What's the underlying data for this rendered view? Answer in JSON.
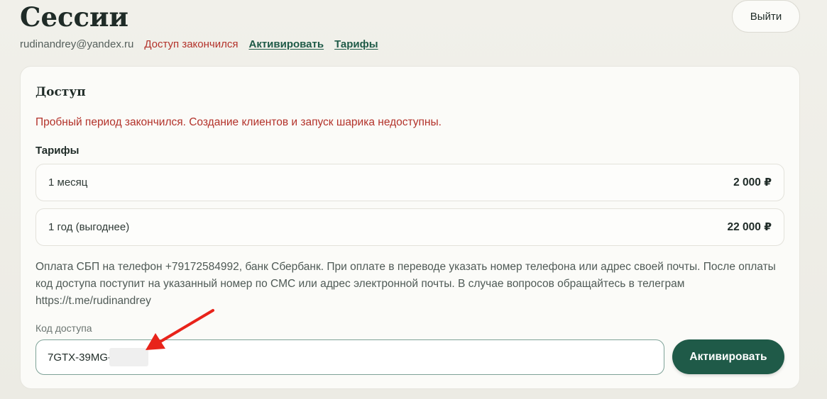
{
  "header": {
    "title": "Сессии",
    "logout_label": "Выйти"
  },
  "status": {
    "email": "rudinandrey@yandex.ru",
    "access_state": "Доступ закончился",
    "activate_link": "Активировать",
    "tariffs_link": "Тарифы"
  },
  "access": {
    "title": "Доступ",
    "warning": "Пробный период закончился. Создание клиентов и запуск шарика недоступны.",
    "tariffs_heading": "Тарифы",
    "plans": [
      {
        "name": "1 месяц",
        "price": "2 000 ₽"
      },
      {
        "name": "1 год (выгоднее)",
        "price": "22 000 ₽"
      }
    ],
    "payment_info": "Оплата СБП на телефон +79172584992, банк Сбербанк. При оплате в переводе указать номер телефона или адрес своей почты. После оплаты код доступа поступит на указанный номер по СМС или адрес электронной почты. В случае вопросов обращайтесь в телеграм https://t.me/rudinandrey",
    "code_label": "Код доступа",
    "code_value": "7GTX-39MG-",
    "activate_button": "Активировать"
  },
  "colors": {
    "accent": "#1f5a48",
    "error": "#b3322a",
    "annotation_arrow": "#e8231a"
  },
  "icons": {
    "annotation": "red-arrow-icon"
  }
}
